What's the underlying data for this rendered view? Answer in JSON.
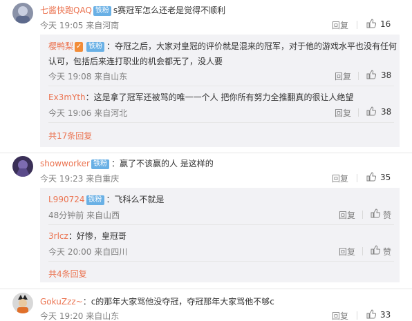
{
  "comments": [
    {
      "user": "七酱快跑QAQ",
      "badge": "铁粉",
      "text": "s赛冠军怎么还老是觉得不顺利",
      "meta": "今天 19:05 来自河南",
      "reply_label": "回复",
      "likes": "16",
      "replies": [
        {
          "user": "樱鸭梨",
          "badge": "铁粉",
          "text_line1": "：夺冠之后，大家对皇冠的评价就是混来的冠军，对于他的游戏水平也没有任何",
          "text_line2": "认可，包括后来连打职业的机会都无了，没人要",
          "meta": "今天 19:08 来自山东",
          "reply_label": "回复",
          "likes": "38"
        },
        {
          "user": "Ex3mYth",
          "text": "：这是拿了冠军还被骂的唯一一个人 把你所有努力全推翻真的很让人绝望",
          "meta": "今天 19:06 来自河北",
          "reply_label": "回复",
          "likes": "38"
        }
      ],
      "more_replies": "共17条回复"
    },
    {
      "user": "showworker",
      "badge": "铁粉",
      "text": "：赢了不该赢的人 是这样的",
      "meta": "今天 19:23 来自重庆",
      "reply_label": "回复",
      "likes": "35",
      "replies": [
        {
          "user": "L990724",
          "badge": "铁粉",
          "text": "：飞科么不就是",
          "meta": "48分钟前 来自山西",
          "reply_label": "回复",
          "likes": "赞"
        },
        {
          "user": "3rlcz",
          "text": "：好惨，皇冠哥",
          "meta": "今天 20:00 来自四川",
          "reply_label": "回复",
          "likes": "赞"
        }
      ],
      "more_replies": "共4条回复"
    },
    {
      "user": "GokuZzz~",
      "text": "：c的那年大家骂他没夺冠，夺冠那年大家骂他不够c",
      "meta": "今天 19:20 来自山东",
      "reply_label": "回复",
      "likes": "33"
    }
  ],
  "colors": {
    "name": "#eb7350",
    "badge_fan": "#69b0e5",
    "badge_vip": "#f28c38",
    "reply_bg": "#f2f2f5"
  }
}
